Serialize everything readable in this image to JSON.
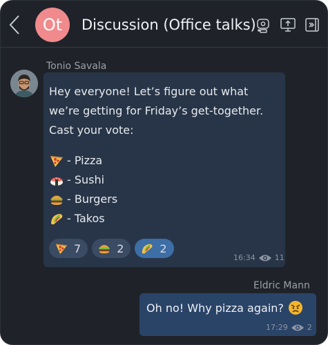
{
  "header": {
    "avatar_initials": "Ot",
    "title": "Discussion (Office talks)",
    "avatar_color": "#f08a8d"
  },
  "messages": [
    {
      "sender": "Tonio Savala",
      "text": "Hey everyone! Let’s figure out what we’re getting for Friday’s get-together. Cast your vote:",
      "options": [
        {
          "icon": "pizza-icon",
          "label": "- Pizza"
        },
        {
          "icon": "sushi-icon",
          "label": "- Sushi"
        },
        {
          "icon": "burger-icon",
          "label": "- Burgers"
        },
        {
          "icon": "taco-icon",
          "label": "- Takos"
        }
      ],
      "reactions": [
        {
          "icon": "pizza-icon",
          "count": "7",
          "active": false
        },
        {
          "icon": "burger-icon",
          "count": "2",
          "active": false
        },
        {
          "icon": "taco-icon",
          "count": "2",
          "active": true
        }
      ],
      "time": "16:34",
      "views": "11"
    },
    {
      "sender": "Eldric Mann",
      "text": "Oh no! Why pizza again?",
      "emoji": "angry-face-icon",
      "time": "17:29",
      "views": "2"
    }
  ],
  "colors": {
    "background": "#1f2329",
    "incoming_bubble": "#283548",
    "outgoing_bubble": "#2a4468",
    "active_reaction": "#3d6ea5"
  }
}
